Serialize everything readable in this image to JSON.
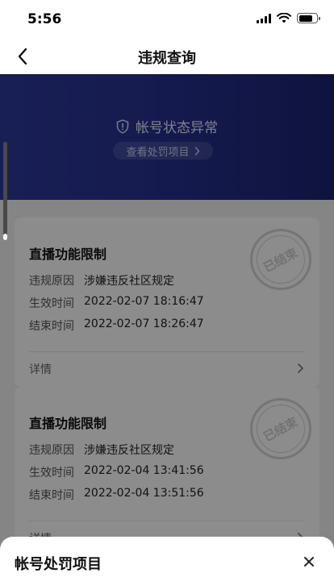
{
  "status_bar": {
    "time": "5:56"
  },
  "nav": {
    "title": "违规查询"
  },
  "banner": {
    "status_text": "帐号状态异常",
    "link_label": "查看处罚项目"
  },
  "records": [
    {
      "title": "直播功能限制",
      "reason_label": "违规原因",
      "reason": "涉嫌违反社区规定",
      "start_label": "生效时间",
      "start": "2022-02-07 18:16:47",
      "end_label": "结束时间",
      "end": "2022-02-07 18:26:47",
      "detail_label": "详情",
      "stamp": "已结束"
    },
    {
      "title": "直播功能限制",
      "reason_label": "违规原因",
      "reason": "涉嫌违反社区规定",
      "start_label": "生效时间",
      "start": "2022-02-04 13:41:56",
      "end_label": "结束时间",
      "end": "2022-02-04 13:51:56",
      "detail_label": "详情",
      "stamp": "已结束"
    }
  ],
  "sheet": {
    "title": "帐号处罚项目"
  },
  "colors": {
    "banner": "#26318f",
    "overlay": "#000000"
  }
}
